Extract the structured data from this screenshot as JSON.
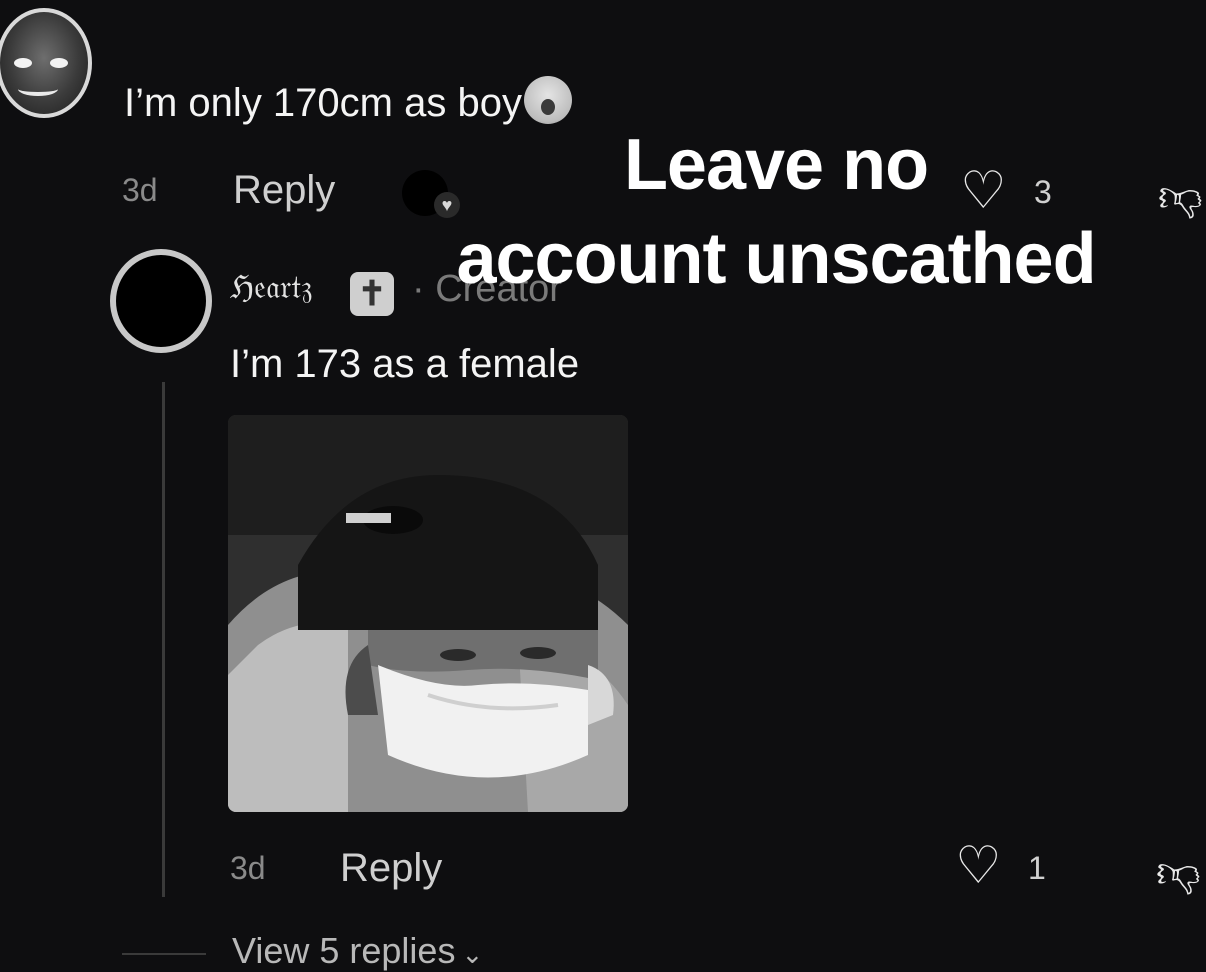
{
  "top_comment": {
    "avatar": "avatar-icon",
    "text": "I’m only 170cm as boy",
    "emoji": "loudly-crying-face-icon",
    "time": "3d",
    "reply_label": "Reply",
    "like_count": "3"
  },
  "overlay": {
    "line1": "Leave no",
    "line2": "account unscathed"
  },
  "reply_comment": {
    "username": "ℌ𝔢𝔞𝔯𝔱𝔷",
    "badge": "✝",
    "creator_tag": "· Creator",
    "text": "I’m 173 as a female",
    "time": "3d",
    "reply_label": "Reply",
    "like_count": "1"
  },
  "view_replies": {
    "label": "View 5 replies"
  },
  "colors": {
    "background": "#0e0e10",
    "text_primary": "#f4f4f4",
    "text_secondary": "#8a8a8a"
  }
}
